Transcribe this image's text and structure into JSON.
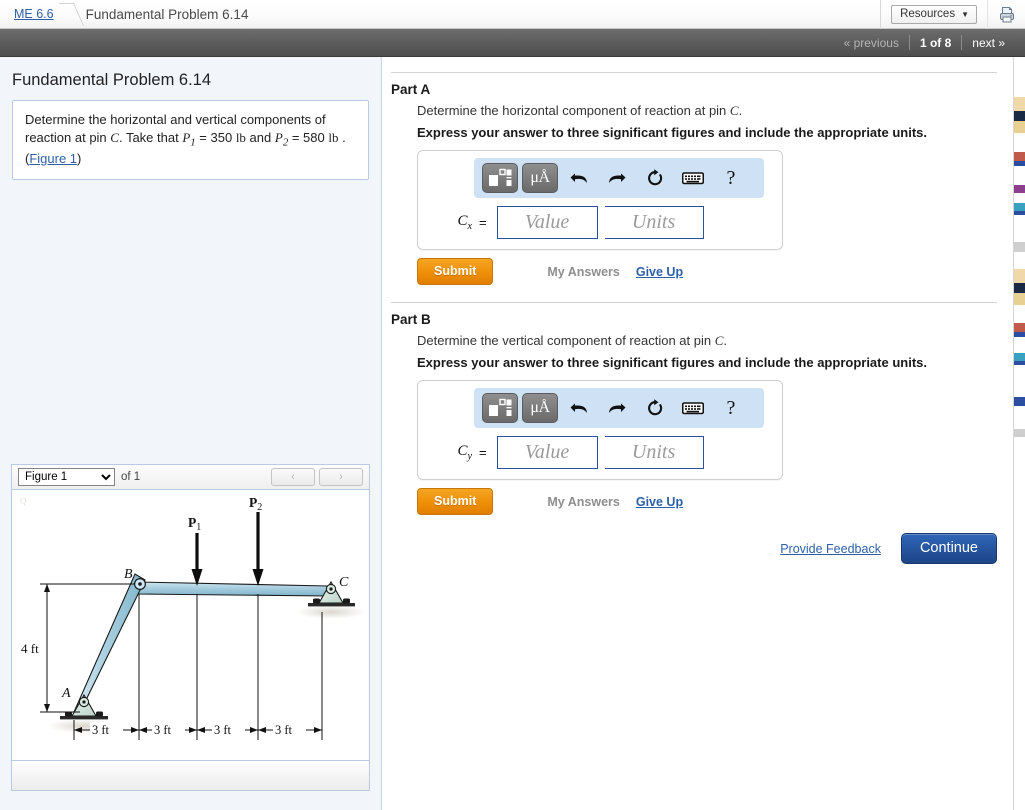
{
  "topbar": {
    "breadcrumb_link": "ME 6.6",
    "breadcrumb_current": "Fundamental Problem 6.14",
    "resources_label": "Resources",
    "resources_caret": "▼",
    "print_icon": "printer-icon"
  },
  "navbar": {
    "previous": "« previous",
    "page_count": "1 of 8",
    "next": "next »"
  },
  "left": {
    "title": "Fundamental Problem 6.14",
    "problem_text_1": "Determine the horizontal and vertical components of reaction at pin ",
    "problem_var_C": "C",
    "problem_text_2": ". Take that ",
    "problem_P1": "P",
    "problem_P1_sub": "1",
    "problem_eq1": " = 350 ",
    "problem_lb1": "lb",
    "problem_and": " and ",
    "problem_P2": "P",
    "problem_P2_sub": "2",
    "problem_eq2": " = 580",
    "problem_lb2": "lb",
    "problem_dot": " .(",
    "figure_link": "Figure 1",
    "problem_close": ")"
  },
  "figure": {
    "selected": "Figure 1",
    "options": [
      "Figure 1"
    ],
    "of_label": "of 1",
    "prev_arrow": "‹",
    "next_arrow": "›",
    "labels": {
      "P1": "P",
      "P1_sub": "1",
      "P2": "P",
      "P2_sub": "2",
      "A": "A",
      "B": "B",
      "C": "C",
      "height": "4 ft",
      "span1": "3 ft",
      "span2": "3 ft",
      "span3": "3 ft",
      "span4": "3 ft"
    }
  },
  "parts": [
    {
      "title": "Part A",
      "prompt_pre": "Determine the horizontal component of reaction at pin ",
      "prompt_var": "C",
      "prompt_post": ".",
      "instruction": "Express your answer to three significant figures and include the appropriate units.",
      "answer_label_main": "C",
      "answer_label_sub": "x",
      "equals": "=",
      "value_placeholder": "Value",
      "units_placeholder": "Units",
      "value_current": "",
      "units_current": "",
      "toolbar": {
        "template_icon": "math-template-icon",
        "units_label": "μÅ",
        "undo_icon": "undo-arrow-icon",
        "redo_icon": "redo-arrow-icon",
        "reset_icon": "reset-circular-arrow-icon",
        "keyboard_icon": "keyboard-icon",
        "help_label": "?"
      },
      "submit_label": "Submit",
      "my_answers_label": "My Answers",
      "give_up_label": "Give Up"
    },
    {
      "title": "Part B",
      "prompt_pre": "Determine the vertical component of reaction at pin ",
      "prompt_var": "C",
      "prompt_post": ".",
      "instruction": "Express your answer to three significant figures and include the appropriate units.",
      "answer_label_main": "C",
      "answer_label_sub": "y",
      "equals": "=",
      "value_placeholder": "Value",
      "units_placeholder": "Units",
      "value_current": "",
      "units_current": "",
      "toolbar": {
        "template_icon": "math-template-icon",
        "units_label": "μÅ",
        "undo_icon": "undo-arrow-icon",
        "redo_icon": "redo-arrow-icon",
        "reset_icon": "reset-circular-arrow-icon",
        "keyboard_icon": "keyboard-icon",
        "help_label": "?"
      },
      "submit_label": "Submit",
      "my_answers_label": "My Answers",
      "give_up_label": "Give Up"
    }
  ],
  "footer": {
    "provide_feedback": "Provide Feedback",
    "continue_label": "Continue"
  },
  "colors": {
    "accent_blue": "#2d5fa8",
    "submit_orange": "#ef8f08",
    "continue_blue": "#24529c",
    "toolbar_blue": "#cfe2f5",
    "panel_bg": "#f2f6fb",
    "beam_blue": "#a8cfe0"
  }
}
